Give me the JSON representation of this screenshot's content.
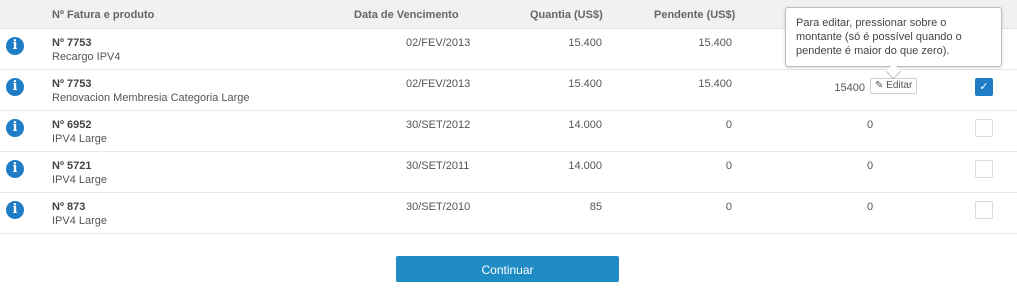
{
  "header": {
    "col_invoice": "Nº Fatura e produto",
    "col_due": "Data de Vencimento",
    "col_amount": "Quantia (US$)",
    "col_pending": "Pendente (US$)"
  },
  "rows": [
    {
      "number": "Nº 7753",
      "product": "Recargo IPV4",
      "due": "02/FEV/2013",
      "amount": "15.400",
      "pending": "15.400"
    },
    {
      "number": "Nº 7753",
      "product": "Renovacion Membresia Categoria Large",
      "due": "02/FEV/2013",
      "amount": "15.400",
      "pending": "15.400",
      "edit_value": "15400",
      "edit_label": "Editar",
      "checked": true
    },
    {
      "number": "Nº 6952",
      "product": "IPV4 Large",
      "due": "30/SET/2012",
      "amount": "14.000",
      "pending": "0",
      "edit_value": "0",
      "checked": false
    },
    {
      "number": "Nº 5721",
      "product": "IPV4 Large",
      "due": "30/SET/2011",
      "amount": "14.000",
      "pending": "0",
      "edit_value": "0",
      "checked": false
    },
    {
      "number": "Nº 873",
      "product": "IPV4 Large",
      "due": "30/SET/2010",
      "amount": "85",
      "pending": "0",
      "edit_value": "0",
      "checked": false
    }
  ],
  "tooltip": {
    "text": "Para editar, pressionar sobre o montante (só é possível quando o pendente é maior do que zero)."
  },
  "continue_label": "Continuar",
  "icons": {
    "info": "info-icon",
    "edit": "pencil-icon",
    "check": "check-icon"
  },
  "colors": {
    "accent": "#1f7dc5",
    "button": "#1f8cc6"
  }
}
